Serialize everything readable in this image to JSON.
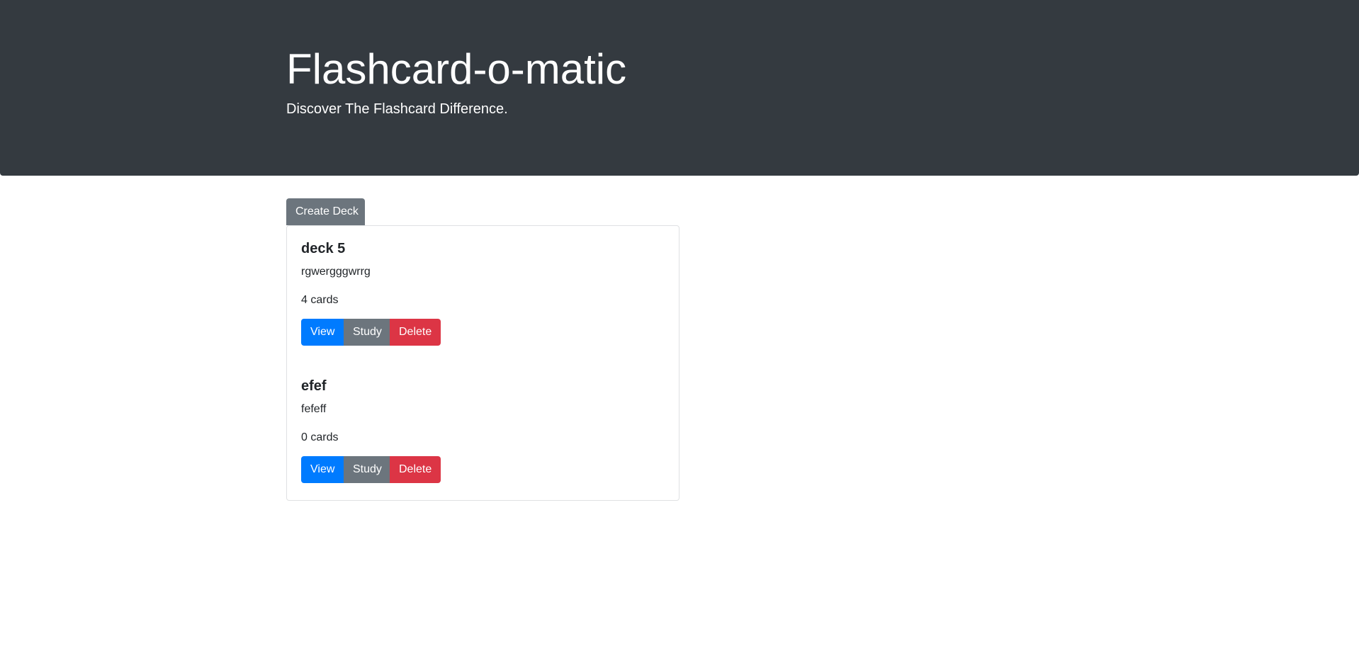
{
  "header": {
    "title": "Flashcard-o-matic",
    "subtitle": "Discover The Flashcard Difference."
  },
  "actions": {
    "create_deck_label": "Create Deck"
  },
  "decks": [
    {
      "name": "deck 5",
      "description": "rgwergggwrrg",
      "card_count": "4 cards",
      "view_label": "View",
      "study_label": "Study",
      "delete_label": "Delete"
    },
    {
      "name": "efef",
      "description": "fefeff",
      "card_count": "0 cards",
      "view_label": "View",
      "study_label": "Study",
      "delete_label": "Delete"
    }
  ],
  "colors": {
    "header_bg": "#343a40",
    "primary": "#007bff",
    "secondary": "#6c757d",
    "danger": "#dc3545"
  }
}
